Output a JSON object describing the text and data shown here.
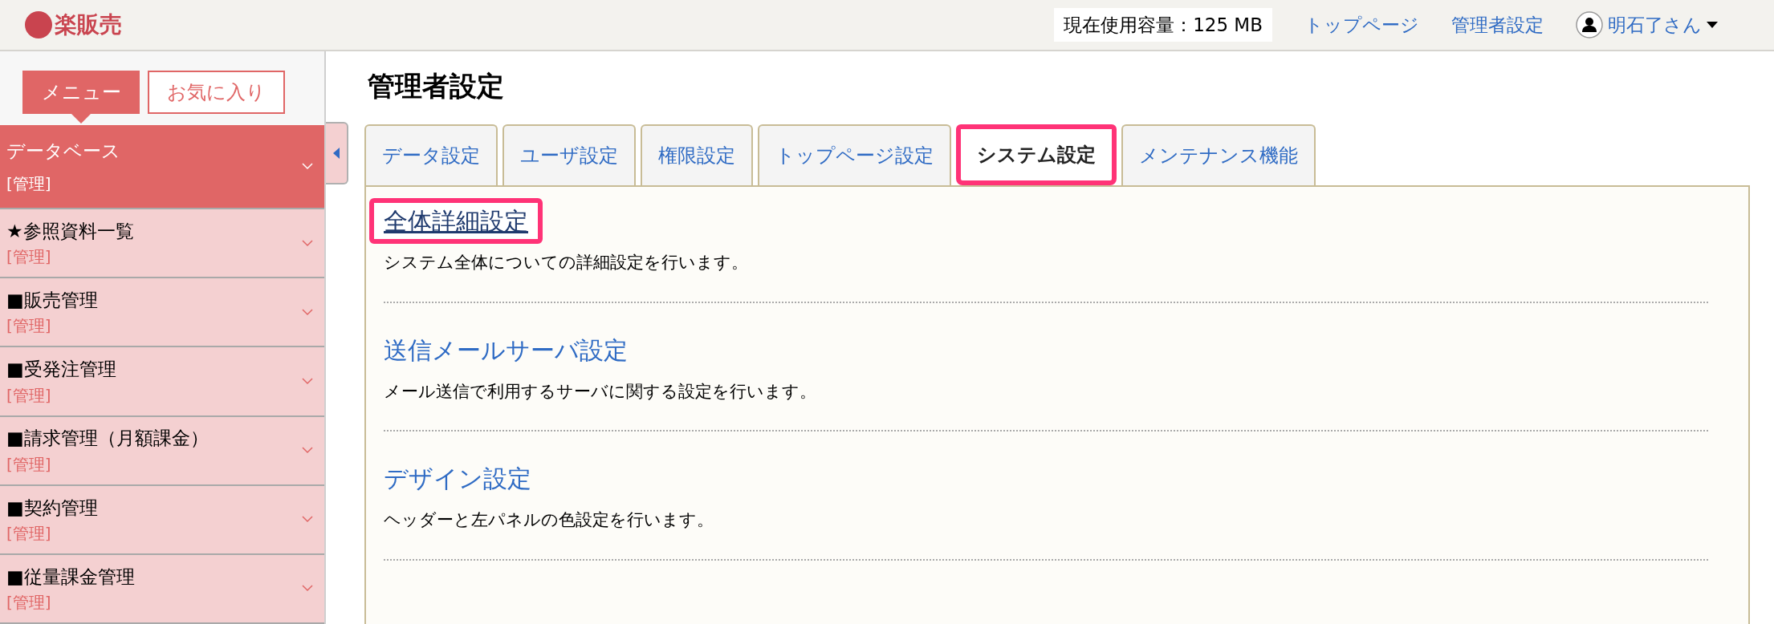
{
  "header": {
    "logo": "楽販売",
    "usage": "現在使用容量：125 MB",
    "links": [
      "トップページ",
      "管理者設定"
    ],
    "user": "明石了さん"
  },
  "sidebar": {
    "tabs": [
      {
        "label": "メニュー",
        "selected": true
      },
      {
        "label": "お気に入り",
        "selected": false
      }
    ],
    "items": [
      {
        "label": "データベース",
        "sub": "[管理]",
        "selected": true
      },
      {
        "label": "★参照資料一覧",
        "sub": "[管理]",
        "selected": false
      },
      {
        "label": "■販売管理",
        "sub": "[管理]",
        "selected": false
      },
      {
        "label": "■受発注管理",
        "sub": "[管理]",
        "selected": false
      },
      {
        "label": "■請求管理（月額課金）",
        "sub": "[管理]",
        "selected": false
      },
      {
        "label": "■契約管理",
        "sub": "[管理]",
        "selected": false
      },
      {
        "label": "■従量課金管理",
        "sub": "[管理]",
        "selected": false
      }
    ]
  },
  "page_title": "管理者設定",
  "tabs": [
    {
      "label": "データ設定",
      "selected": false
    },
    {
      "label": "ユーザ設定",
      "selected": false
    },
    {
      "label": "権限設定",
      "selected": false
    },
    {
      "label": "トップページ設定",
      "selected": false
    },
    {
      "label": "システム設定",
      "selected": true
    },
    {
      "label": "メンテナンス機能",
      "selected": false
    }
  ],
  "sections": [
    {
      "title": "全体詳細設定",
      "description": "システム全体についての詳細設定を行います。",
      "highlighted": true
    },
    {
      "title": "送信メールサーバ設定",
      "description": "メール送信で利用するサーバに関する設定を行います。",
      "highlighted": false
    },
    {
      "title": "デザイン設定",
      "description": "ヘッダーと左パネルの色設定を行います。",
      "highlighted": false
    }
  ]
}
